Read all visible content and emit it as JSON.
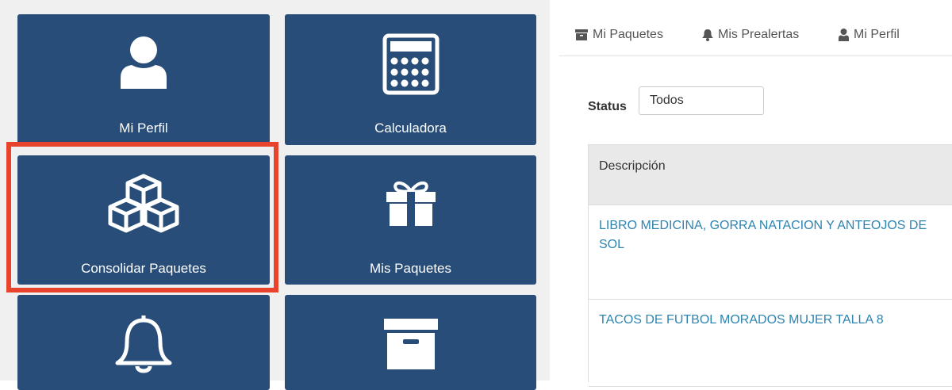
{
  "tiles": [
    {
      "label": "Mi Perfil",
      "icon": "user-icon"
    },
    {
      "label": "Calculadora",
      "icon": "calculator-icon"
    },
    {
      "label": "Consolidar Paquetes",
      "icon": "cubes-icon"
    },
    {
      "label": "Mis Paquetes",
      "icon": "gift-icon"
    },
    {
      "label": "",
      "icon": "bell-icon"
    },
    {
      "label": "",
      "icon": "archive-box-icon"
    }
  ],
  "tabs": [
    {
      "label": "Mi Paquetes",
      "icon": "archive-icon"
    },
    {
      "label": "Mis Prealertas",
      "icon": "bell-icon"
    },
    {
      "label": "Mi Perfil",
      "icon": "user-icon"
    }
  ],
  "filter": {
    "label": "Status",
    "value": "Todos"
  },
  "table": {
    "header": "Descripción",
    "rows": [
      "LIBRO MEDICINA, GORRA NATACION Y ANTEOJOS DE SOL",
      "TACOS DE FUTBOL MORADOS MUJER TALLA 8"
    ]
  },
  "colors": {
    "tile": "#284d79",
    "highlight": "#e8432b",
    "link": "#2d84b0"
  }
}
